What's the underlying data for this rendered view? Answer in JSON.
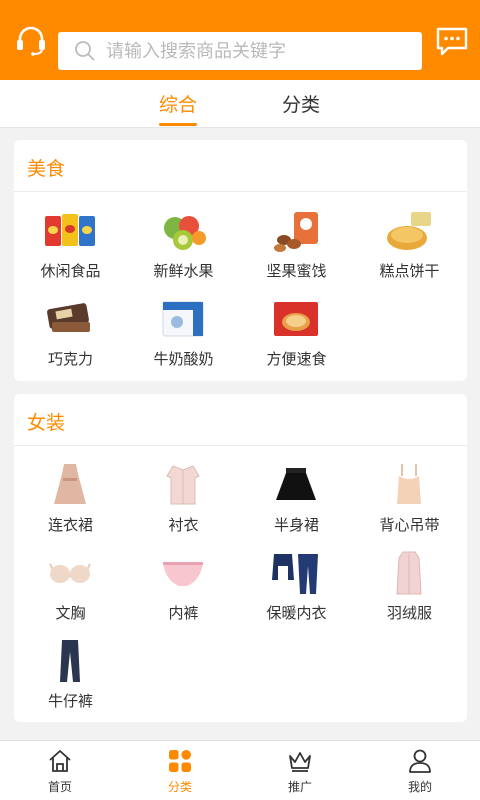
{
  "header": {
    "search_placeholder": "请输入搜索商品关键字",
    "left_icon": "headset-icon",
    "right_icon": "message-icon"
  },
  "tabs": [
    {
      "label": "综合",
      "active": true
    },
    {
      "label": "分类",
      "active": false
    }
  ],
  "sections": [
    {
      "title": "美食",
      "items": [
        {
          "label": "休闲食品",
          "icon": "snacks-icon"
        },
        {
          "label": "新鲜水果",
          "icon": "fruit-icon"
        },
        {
          "label": "坚果蜜饯",
          "icon": "nuts-icon"
        },
        {
          "label": "糕点饼干",
          "icon": "pastry-icon"
        },
        {
          "label": "巧克力",
          "icon": "chocolate-icon"
        },
        {
          "label": "牛奶酸奶",
          "icon": "milk-icon"
        },
        {
          "label": "方便速食",
          "icon": "noodles-icon"
        }
      ]
    },
    {
      "title": "女装",
      "items": [
        {
          "label": "连衣裙",
          "icon": "dress-icon"
        },
        {
          "label": "衬衣",
          "icon": "shirt-icon"
        },
        {
          "label": "半身裙",
          "icon": "skirt-icon"
        },
        {
          "label": "背心吊带",
          "icon": "camisole-icon"
        },
        {
          "label": "文胸",
          "icon": "bra-icon"
        },
        {
          "label": "内裤",
          "icon": "underwear-icon"
        },
        {
          "label": "保暖内衣",
          "icon": "thermal-wear-icon"
        },
        {
          "label": "羽绒服",
          "icon": "down-jacket-icon"
        },
        {
          "label": "牛仔裤",
          "icon": "jeans-icon"
        }
      ]
    }
  ],
  "bottom_nav": [
    {
      "label": "首页",
      "icon": "home-icon",
      "active": false
    },
    {
      "label": "分类",
      "icon": "category-icon",
      "active": true
    },
    {
      "label": "推广",
      "icon": "crown-icon",
      "active": false
    },
    {
      "label": "我的",
      "icon": "user-icon",
      "active": false
    }
  ],
  "colors": {
    "accent": "#ff8a00",
    "background": "#f3f2f2"
  }
}
